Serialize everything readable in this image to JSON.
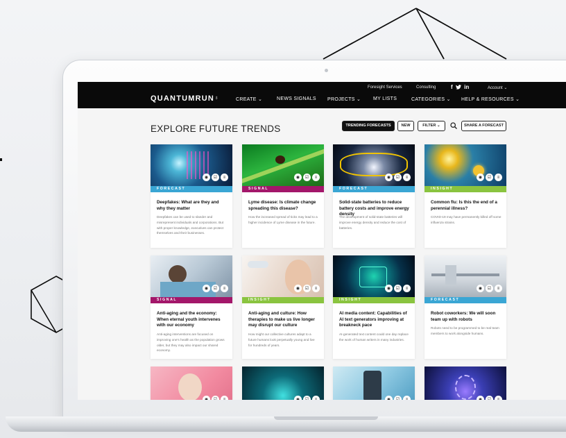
{
  "nav": {
    "logo": "QUANTUMRUN",
    "top_links": [
      "Foresight Services",
      "Consulting",
      "Account"
    ],
    "main_links": [
      "CREATE",
      "NEWS SIGNALS",
      "PROJECTS",
      "MY LISTS",
      "CATEGORIES",
      "HELP & RESOURCES"
    ],
    "social": [
      "f",
      "in"
    ]
  },
  "page": {
    "title": "EXPLORE FUTURE TRENDS",
    "buttons": {
      "trending": "TRENDING FORECASTS",
      "new": "NEW",
      "filter": "FILTER",
      "share": "SHARE A FORECAST"
    }
  },
  "colors": {
    "forecast": "#3aa6d4",
    "signal": "#a3176a",
    "insight": "#8ac43f"
  },
  "cards": [
    {
      "type": "FORECAST",
      "title": "Deepfakes: What are they and why they matter",
      "desc": "Deepfakes can be used to slander and misrepresent individuals and corporations. But with proper knowledge, executives can protect themselves and their businesses."
    },
    {
      "type": "SIGNAL",
      "title": "Lyme disease: Is climate change spreading this disease?",
      "desc": "How the increased spread of ticks may lead to a higher incidence of Lyme disease in the future."
    },
    {
      "type": "FORECAST",
      "title": "Solid-state batteries to reduce battery costs and improve energy density",
      "desc": "The development of solid-state batteries will improve energy density and reduce the cost of batteries."
    },
    {
      "type": "INSIGHT",
      "title": "Common flu: Is this the end of a perennial illness?",
      "desc": "COVID-19 may have permanently killed off some influenza strains."
    },
    {
      "type": "SIGNAL",
      "title": "Anti-aging and the economy: When eternal youth intervenes with our economy",
      "desc": "Anti-aging interventions are focused on improving one's health as the population grows older, but they may also impact our shared economy."
    },
    {
      "type": "INSIGHT",
      "title": "Anti-aging and culture: How therapies to make us live longer may disrupt our culture",
      "desc": "How might our collective cultures adapt to a future humans look perpetually young and live for hundreds of years."
    },
    {
      "type": "INSIGHT",
      "title": "AI media content: Capabilities of AI text generators improving at breakneck pace",
      "desc": "AI-generated text content could one day replace the work of human writers in many industries."
    },
    {
      "type": "FORECAST",
      "title": "Robot coworkers: We will soon team up with robots",
      "desc": "Robots need to be programmed to be real team members to work alongside humans."
    },
    {
      "type": "",
      "title": "",
      "desc": ""
    },
    {
      "type": "",
      "title": "",
      "desc": ""
    },
    {
      "type": "",
      "title": "",
      "desc": ""
    },
    {
      "type": "",
      "title": "",
      "desc": ""
    }
  ],
  "icons": [
    "eye-icon",
    "checklist-icon",
    "list-icon",
    "search-icon",
    "chevron-down-icon",
    "twitter-icon"
  ]
}
